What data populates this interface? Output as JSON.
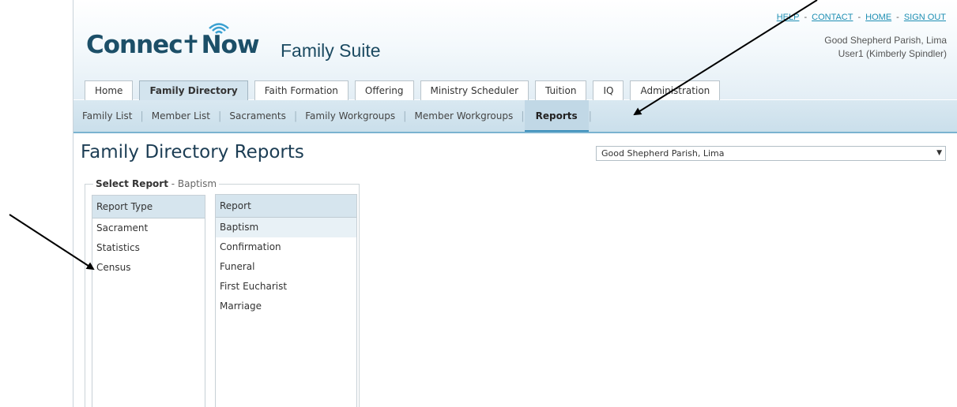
{
  "header": {
    "logo_text": "Connect Now",
    "suite_title": "Family Suite",
    "top_links": [
      "HELP",
      "CONTACT",
      "HOME",
      "SIGN OUT"
    ],
    "link_separator": "-",
    "parish_name": "Good Shepherd Parish, Lima",
    "user_name": "User1 (Kimberly Spindler)"
  },
  "main_tabs": [
    {
      "label": "Home",
      "active": false
    },
    {
      "label": "Family Directory",
      "active": true
    },
    {
      "label": "Faith Formation",
      "active": false
    },
    {
      "label": "Offering",
      "active": false
    },
    {
      "label": "Ministry Scheduler",
      "active": false
    },
    {
      "label": "Tuition",
      "active": false
    },
    {
      "label": "IQ",
      "active": false
    },
    {
      "label": "Administration",
      "active": false
    }
  ],
  "sub_nav": [
    {
      "label": "Family List",
      "active": false
    },
    {
      "label": "Member List",
      "active": false
    },
    {
      "label": "Sacraments",
      "active": false
    },
    {
      "label": "Family Workgroups",
      "active": false
    },
    {
      "label": "Member Workgroups",
      "active": false
    },
    {
      "label": "Reports",
      "active": true
    }
  ],
  "page": {
    "title": "Family Directory Reports",
    "parish_select": {
      "value": "Good Shepherd Parish, Lima"
    }
  },
  "select_report": {
    "legend": "Select Report",
    "legend_sub": " - Baptism",
    "type_header": "Report Type",
    "report_types": [
      "Sacrament",
      "Statistics",
      "Census"
    ],
    "report_header": "Report",
    "reports": [
      "Baptism",
      "Confirmation",
      "Funeral",
      "First Eucharist",
      "Marriage"
    ]
  },
  "colors": {
    "brand_dark": "#1c4f68",
    "link": "#1e8fb3",
    "tab_active_bg": "#d3e4ee",
    "subnav_bg": "#cadfeb"
  }
}
